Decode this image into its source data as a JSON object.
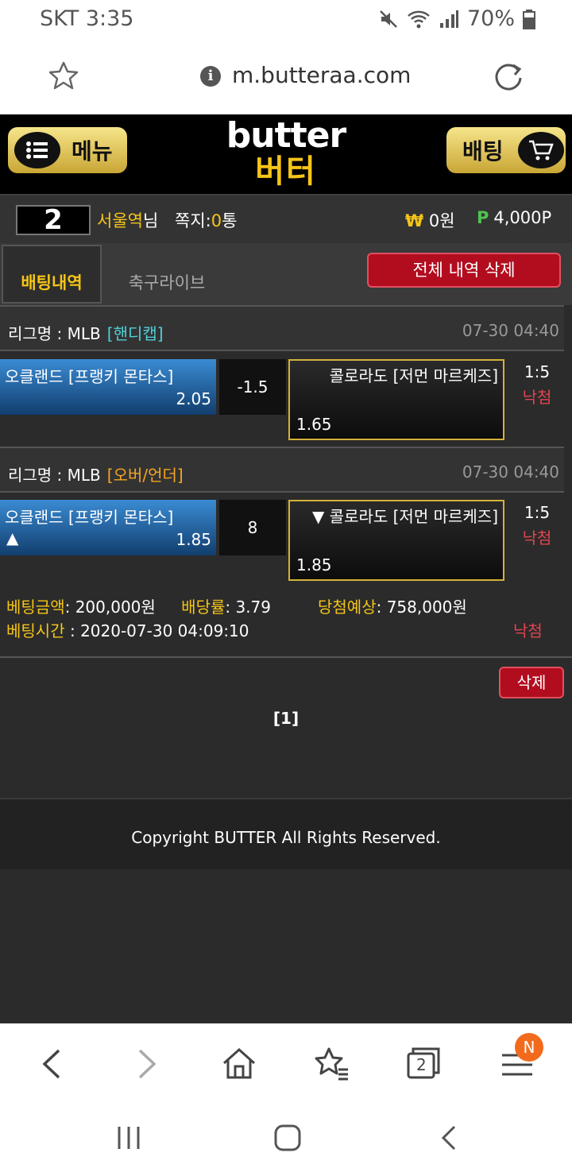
{
  "status_bar": {
    "carrier_time": "SKT 3:35",
    "battery": "70%"
  },
  "browser": {
    "url": "m.butteraa.com",
    "tab_count": "2",
    "badge": "N"
  },
  "header": {
    "menu_label": "메뉴",
    "bet_label": "배팅",
    "logo_en": "butter",
    "logo_ko": "버터"
  },
  "user": {
    "level": "2",
    "name": "서울역",
    "name_suffix": "님",
    "memo_label": "쪽지:",
    "memo_value": "0",
    "memo_unit": "통",
    "money_symbol": "₩",
    "money": "0원",
    "point_symbol": "P",
    "points": "4,000P"
  },
  "tabs": {
    "active": "배팅내역",
    "inactive": "축구라이브",
    "delete_all": "전체 내역 삭제"
  },
  "bets": [
    {
      "league_label": "리그명 : MLB",
      "market": "[핸디캡]",
      "market_color": "#4fd1d9",
      "time": "07-30 04:40",
      "home_team": "오클랜드 [프랭키 몬타스]",
      "home_odds": "2.05",
      "line": "-1.5",
      "away_team": "콜로라도 [저먼 마르케즈]",
      "away_odds": "1.65",
      "score": "1:5",
      "status": "낙첨"
    },
    {
      "league_label": "리그명 : MLB",
      "market": "[오버/언더]",
      "market_color": "#f5a623",
      "time": "07-30 04:40",
      "home_team": "오클랜드 [프랭키 몬타스]",
      "home_arrow": "▲",
      "home_odds": "1.85",
      "line": "8",
      "away_team": "▼ 콜로라도 [저먼 마르케즈]",
      "away_odds": "1.85",
      "score": "1:5",
      "status": "낙첨"
    }
  ],
  "summary": {
    "amount_label": "베팅금액",
    "amount": ": 200,000원",
    "rate_label": "배당률",
    "rate": ": 3.79",
    "expected_label": "당첨예상",
    "expected": ": 758,000원",
    "time_label": "베팅시간",
    "time": " : 2020-07-30 04:09:10",
    "status": "낙첨"
  },
  "delete_button": "삭제",
  "pager": "[1]",
  "footer": "Copyright BUTTER All Rights Reserved."
}
